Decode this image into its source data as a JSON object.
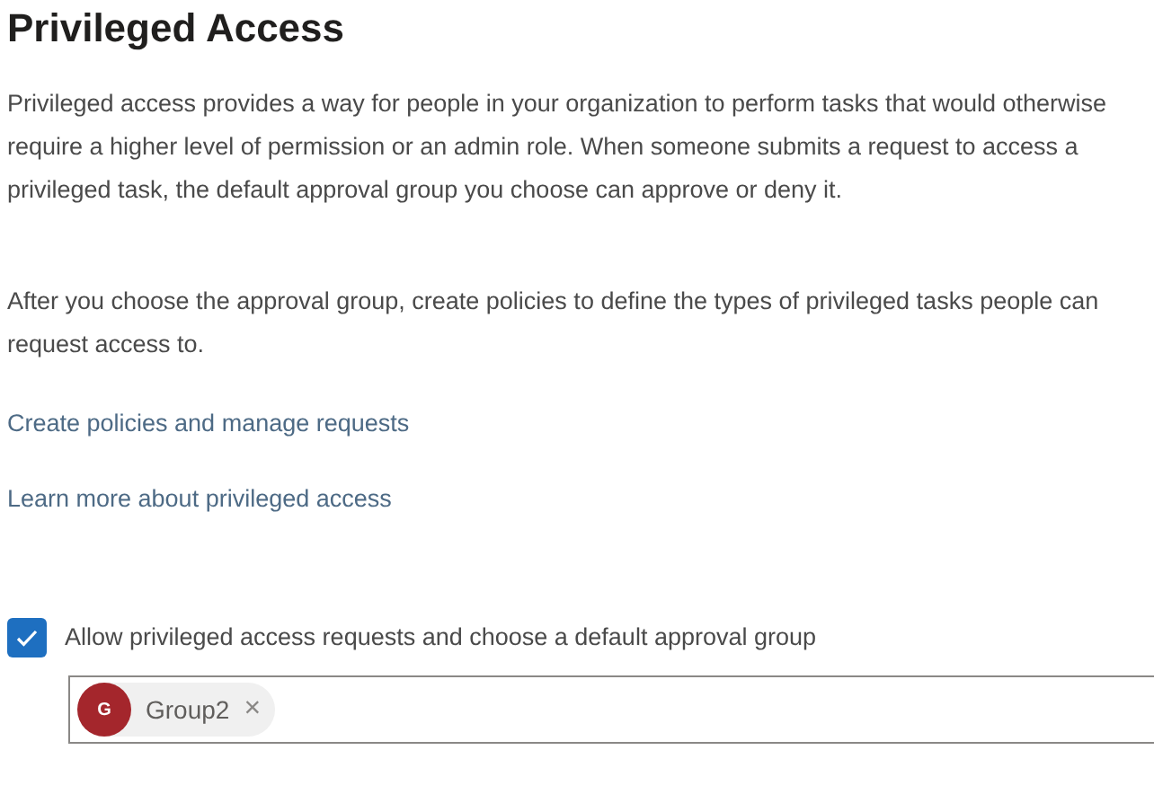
{
  "title": "Privileged Access",
  "paragraphs": [
    "Privileged access provides a way for people in your organization to perform tasks that would otherwise require a higher level of permission or an admin role. When someone submits a request to access a privileged task, the default approval group you choose can approve or deny it.",
    "After you choose the approval group, create policies to define the types of privileged tasks people can request access to."
  ],
  "links": [
    "Create policies and manage requests",
    "Learn more about privileged access"
  ],
  "allow_checkbox": {
    "label": "Allow privileged access requests and choose a default approval group",
    "checked": true
  },
  "approval_group_field": {
    "chips": [
      {
        "initial": "G",
        "label": "Group2",
        "remove": "×",
        "color": "#a4262c"
      }
    ]
  }
}
